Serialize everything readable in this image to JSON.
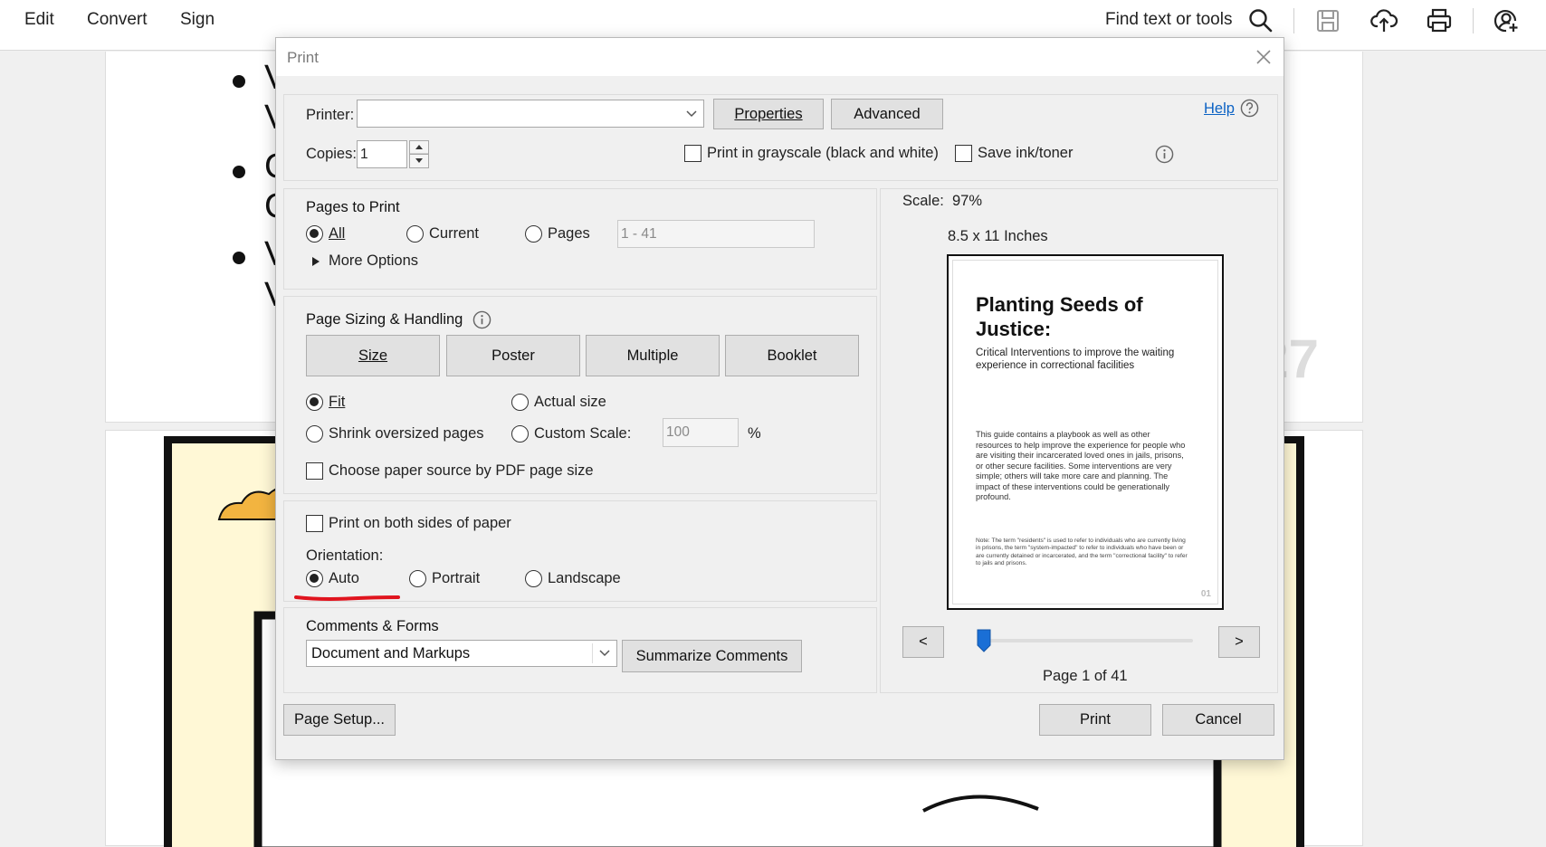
{
  "toolbar": {
    "menu": [
      "Edit",
      "Convert",
      "Sign"
    ],
    "find_label": "Find text or tools",
    "icons": [
      "search-icon",
      "save-icon",
      "upload-cloud-icon",
      "print-icon",
      "account-icon"
    ]
  },
  "document": {
    "bullet_letters": [
      "V",
      "V",
      "C",
      "C",
      "V",
      "V"
    ]
  },
  "dialog": {
    "title": "Print",
    "printer": {
      "label": "Printer:",
      "value": "",
      "properties_button": "Properties",
      "advanced_button": "Advanced",
      "help_link": "Help"
    },
    "copies": {
      "label": "Copies:",
      "value": "1"
    },
    "grayscale_label": "Print in grayscale (black and white)",
    "grayscale_checked": false,
    "save_ink_label": "Save ink/toner",
    "save_ink_checked": false,
    "pages_to_print": {
      "title": "Pages to Print",
      "options": [
        "All",
        "Current",
        "Pages"
      ],
      "selected": "All",
      "pages_range_placeholder": "1 - 41",
      "more_options": "More Options"
    },
    "sizing": {
      "title": "Page Sizing & Handling",
      "tabs": [
        "Size",
        "Poster",
        "Multiple",
        "Booklet"
      ],
      "fit_label": "Fit",
      "actual_size_label": "Actual size",
      "shrink_label": "Shrink oversized pages",
      "custom_scale_label": "Custom Scale:",
      "custom_scale_value": "100",
      "percent": "%",
      "selected": "Fit",
      "paper_source_label": "Choose paper source by PDF page size",
      "paper_source_checked": false
    },
    "both_sides_label": "Print on both sides of paper",
    "both_sides_checked": false,
    "orientation": {
      "label": "Orientation:",
      "options": [
        "Auto",
        "Portrait",
        "Landscape"
      ],
      "selected": "Auto"
    },
    "comments_forms": {
      "title": "Comments & Forms",
      "value": "Document and Markups",
      "summarize_button": "Summarize Comments"
    },
    "preview": {
      "scale_label": "Scale:",
      "scale_value": "97%",
      "paper_size": "8.5 x 11 Inches",
      "page_title": "Planting Seeds of Justice:",
      "page_subtitle": "Critical Interventions to improve the waiting experience in correctional facilities",
      "page_body": "This guide contains a playbook as well as other resources to help improve the experience for people who are visiting their incarcerated loved ones in jails, prisons, or other secure facilities. Some interventions are very simple; others will take more care and planning. The impact of these interventions could be generationally profound.",
      "page_note": "Note: The term \"residents\" is used to refer to individuals who are currently living in prisons, the term \"system-impacted\" to refer to individuals who have been or are currently detained or incarcerated, and the term \"correctional facility\" to refer to jails and prisons.",
      "page_number": "01",
      "prev_button": "<",
      "next_button": ">",
      "page_indicator": "Page 1 of 41",
      "slider_position": 0
    },
    "page_setup_button": "Page Setup...",
    "print_button": "Print",
    "cancel_button": "Cancel"
  },
  "colors": {
    "annotation_red": "#e0141e",
    "slider_thumb": "#1a6fd6",
    "link_blue": "#0b62c4"
  }
}
